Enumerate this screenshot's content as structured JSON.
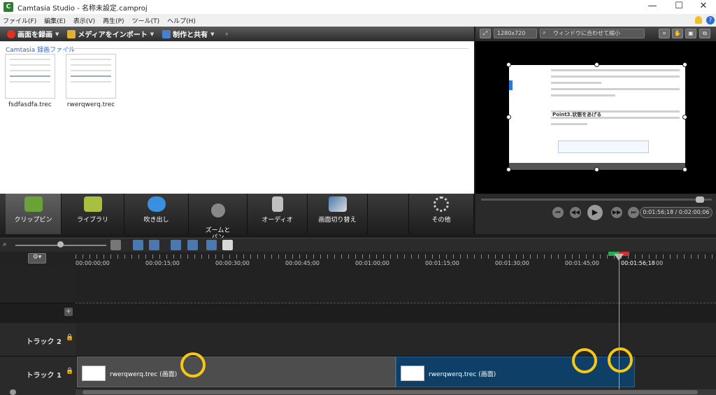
{
  "window": {
    "title": "Camtasia Studio - 名称未設定.camproj",
    "icon_letter": "C",
    "min": "—",
    "max": "☐",
    "close": "✕"
  },
  "menu": [
    "ファイル(F)",
    "編集(E)",
    "表示(V)",
    "再生(P)",
    "ツール(T)",
    "ヘルプ(H)"
  ],
  "toolbar": {
    "record": "画面を録画",
    "import": "メディアをインポート",
    "produce": "制作と共有"
  },
  "clipbin": {
    "header": "Camtasia 録画ファイル",
    "items": [
      {
        "label": "fsdfasdfa.trec"
      },
      {
        "label": "rwerqwerq.trec"
      }
    ]
  },
  "preview": {
    "size": "1280x720",
    "zoom": "ウィンドウに合わせて縮小",
    "point_text": "Point3.状態をあげる",
    "time": "0:01:56;18 / 0:02:00;06"
  },
  "tabs": [
    {
      "label": "クリップビン"
    },
    {
      "label": "ライブラリ"
    },
    {
      "label": "吹き出し"
    },
    {
      "label": "ズームと\nパン"
    },
    {
      "label": "オーディオ"
    },
    {
      "label": "画面切り替え"
    },
    {
      "label": "その他"
    }
  ],
  "ruler": [
    "00:00:00;00",
    "00:00:15;00",
    "00:00:30;00",
    "00:00:45;00",
    "00:01:00;00",
    "00:01:15;00",
    "00:01:30;00",
    "00:01:45;00",
    "00:01:56;18",
    "00"
  ],
  "tracks": {
    "track2": "トラック 2",
    "track1": "トラック 1",
    "clip1": "rwerqwerq.trec (画面)",
    "clip2": "rwerqwerq.trec (画面)"
  },
  "colors": {
    "accent": "#2a6ad0",
    "clip_gray": "#4d4d4d",
    "clip_blue": "#0e3f66",
    "highlight": "#f6c715"
  }
}
